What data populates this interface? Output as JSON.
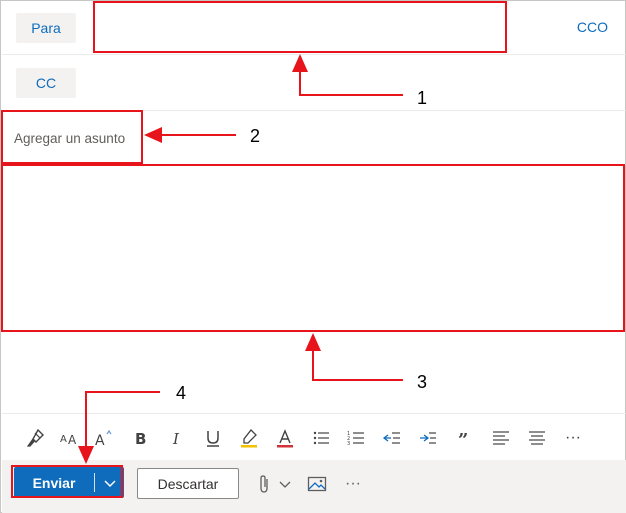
{
  "recipients": {
    "to_label": "Para",
    "cc_label": "CC",
    "bcc_link": "CCO",
    "to_value": ""
  },
  "subject": {
    "placeholder": "Agregar un asunto",
    "value": ""
  },
  "body": {
    "value": ""
  },
  "callouts": [
    "1",
    "2",
    "3",
    "4"
  ],
  "format_toolbar": {
    "icons": [
      "format-painter-icon",
      "font-size-icon",
      "superscript-font-icon",
      "bold-icon",
      "italic-icon",
      "underline-icon",
      "highlight-icon",
      "font-color-icon",
      "bullets-icon",
      "numbering-icon",
      "decrease-indent-icon",
      "increase-indent-icon",
      "quote-icon",
      "align-left-icon",
      "align-center-icon",
      "more-options-icon"
    ],
    "more": "···"
  },
  "actions": {
    "send_label": "Enviar",
    "discard_label": "Descartar",
    "more": "···"
  },
  "colors": {
    "accent": "#0f6cbd",
    "annotation": "#e8141b"
  }
}
